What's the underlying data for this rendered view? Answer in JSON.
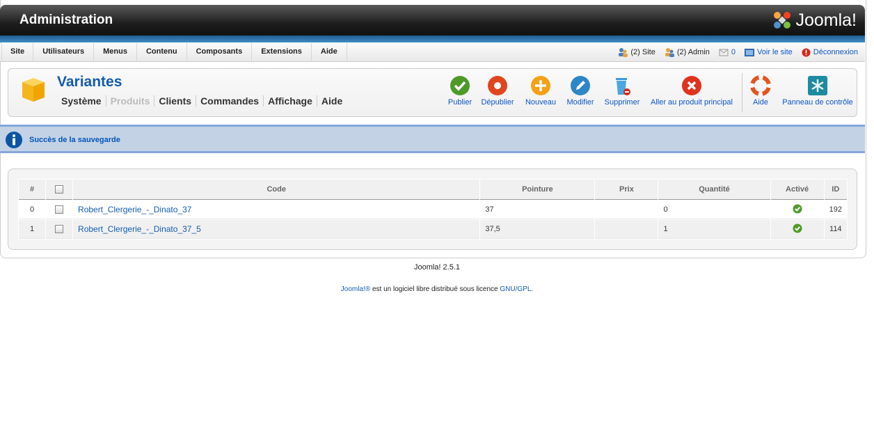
{
  "header": {
    "title": "Administration",
    "logo_text": "Joomla!"
  },
  "menu": {
    "items": [
      "Site",
      "Utilisateurs",
      "Menus",
      "Contenu",
      "Composants",
      "Extensions",
      "Aide"
    ]
  },
  "status": {
    "site_users": "(2) Site",
    "admin_users": "(2) Admin",
    "messages": "0",
    "view_site": "Voir le site",
    "logout": "Déconnexion"
  },
  "page": {
    "title": "Variantes"
  },
  "submenu": {
    "items": [
      "Système",
      "Produits",
      "Clients",
      "Commandes",
      "Affichage",
      "Aide"
    ],
    "disabled_index": 1
  },
  "toolbar": {
    "publish": "Publier",
    "unpublish": "Dépublier",
    "new": "Nouveau",
    "edit": "Modifier",
    "delete": "Supprimer",
    "main_product": "Aller au produit principal",
    "help": "Aide",
    "control_panel": "Panneau de contrôle"
  },
  "message": {
    "text": "Succès de la sauvegarde"
  },
  "table": {
    "headers": [
      "#",
      "",
      "Code",
      "Pointure",
      "Prix",
      "Quantité",
      "Activé",
      "ID"
    ],
    "rows": [
      {
        "num": "0",
        "code": "Robert_Clergerie_-_Dinato_37",
        "size": "37",
        "price": "",
        "qty": "0",
        "enabled": true,
        "id": "192"
      },
      {
        "num": "1",
        "code": "Robert_Clergerie_-_Dinato_37_5",
        "size": "37,5",
        "price": "",
        "qty": "1",
        "enabled": true,
        "id": "114"
      }
    ]
  },
  "footer": {
    "version": "Joomla! 2.5.1",
    "license_link": "Joomla!®",
    "license_text": " est un logiciel libre distribué sous licence ",
    "gpl_link": "GNU/GPL",
    "period": "."
  },
  "colors": {
    "accent": "#135cae",
    "header_dark": "#1e1e1e",
    "message_bg": "#c3d2e5"
  }
}
